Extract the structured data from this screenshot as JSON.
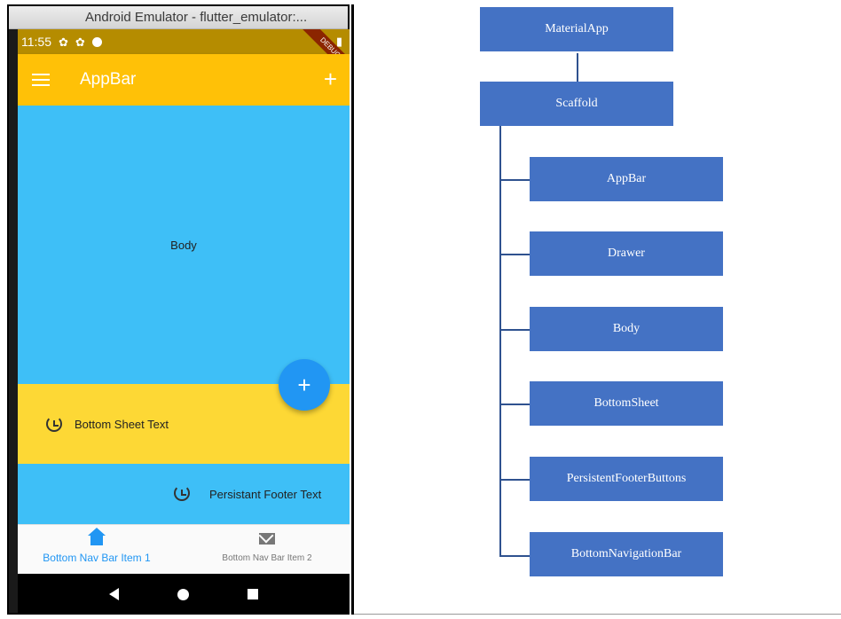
{
  "emulator": {
    "window_title": "Android Emulator - flutter_emulator:...",
    "status_time": "11:55",
    "debug_label": "DEBUG",
    "appbar_title": "AppBar",
    "body_text": "Body",
    "bottom_sheet_text": "Bottom Sheet Text",
    "footer_text": "Persistant Footer Text",
    "fab_label": "+",
    "add_action_label": "+",
    "nav_items": [
      {
        "label": "Bottom Nav Bar Item 1",
        "icon": "home-icon",
        "active": true
      },
      {
        "label": "Bottom Nav Bar Item 2",
        "icon": "mail-icon",
        "active": false
      }
    ],
    "colors": {
      "appbar": "#ffc107",
      "status_bar": "#b58c00",
      "body": "#3ebff7",
      "bottom_sheet": "#fdd835",
      "fab": "#2196f3",
      "nav_active": "#2196f3"
    }
  },
  "diagram": {
    "root": "MaterialApp",
    "scaffold": "Scaffold",
    "children": [
      "AppBar",
      "Drawer",
      "Body",
      "BottomSheet",
      "PersistentFooterButtons",
      "BottomNavigationBar"
    ],
    "node_color": "#4472c4"
  }
}
